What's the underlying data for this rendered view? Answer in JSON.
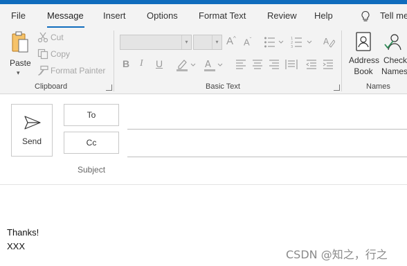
{
  "tabs": [
    {
      "label": "File"
    },
    {
      "label": "Message"
    },
    {
      "label": "Insert"
    },
    {
      "label": "Options"
    },
    {
      "label": "Format Text"
    },
    {
      "label": "Review"
    },
    {
      "label": "Help"
    }
  ],
  "active_tab": "Message",
  "tell_me": "Tell me",
  "ribbon": {
    "clipboard": {
      "group_label": "Clipboard",
      "paste_label": "Paste",
      "cut_label": "Cut",
      "copy_label": "Copy",
      "format_painter_label": "Format Painter"
    },
    "basic_text": {
      "group_label": "Basic Text",
      "font_name_value": "",
      "font_size_value": ""
    },
    "names": {
      "group_label": "Names",
      "address_book_line1": "Address",
      "address_book_line2": "Book",
      "check_names_line1": "Check",
      "check_names_line2": "Names"
    }
  },
  "compose": {
    "send_label": "Send",
    "to_label": "To",
    "cc_label": "Cc",
    "subject_label": "Subject",
    "to_value": "",
    "cc_value": "",
    "subject_value": "",
    "body_lines": [
      "Thanks!",
      "XXX"
    ]
  },
  "watermark": "CSDN @知之，行之",
  "colors": {
    "accent": "#0f6cbd",
    "ribbon_bg": "#f3f3f3",
    "disabled": "#a6a6a6"
  }
}
